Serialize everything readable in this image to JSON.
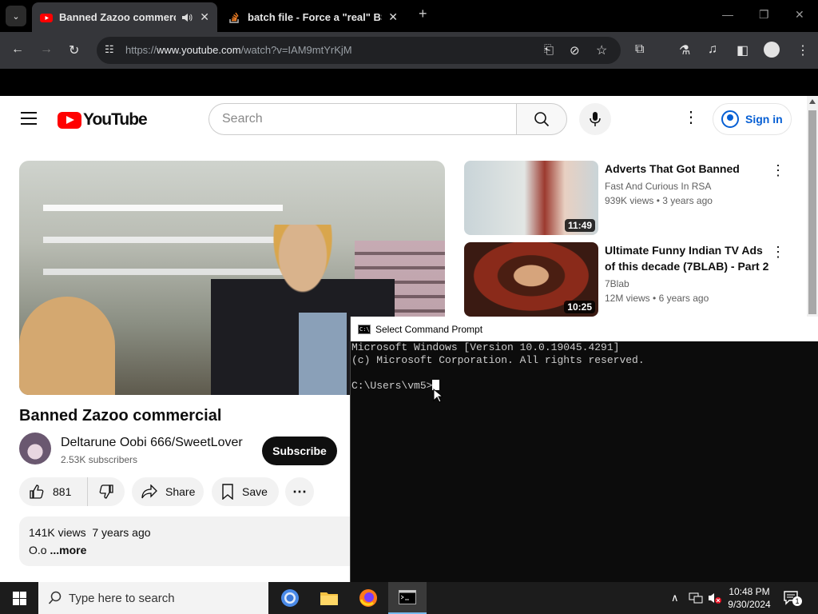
{
  "browser": {
    "tabs": [
      {
        "title": "Banned Zazoo commercial",
        "active": true,
        "audio": true
      },
      {
        "title": "batch file - Force a \"real\" BSoD",
        "active": false
      }
    ],
    "url_prefix": "https://",
    "url_host": "www.youtube.com",
    "url_path": "/watch?v=IAM9mtYrKjM"
  },
  "youtube": {
    "logo_text": "YouTube",
    "search_placeholder": "Search",
    "signin_label": "Sign in",
    "video": {
      "title": "Banned Zazoo commercial",
      "channel": "Deltarune Oobi 666/SweetLover",
      "subscribers": "2.53K subscribers",
      "subscribe_label": "Subscribe",
      "likes": "881",
      "share_label": "Share",
      "save_label": "Save",
      "views": "141K views",
      "age": "7 years ago",
      "description": "O.o",
      "more_label": "...more"
    },
    "recommendations": [
      {
        "title": "Adverts That Got Banned",
        "channel": "Fast And Curious In RSA",
        "views": "939K views",
        "age": "3 years ago",
        "duration": "11:49"
      },
      {
        "title": "Ultimate Funny Indian TV Ads of this decade (7BLAB) - Part 2",
        "channel": "7Blab",
        "views": "12M views",
        "age": "6 years ago",
        "duration": "10:25"
      }
    ]
  },
  "cmd": {
    "title": "Select Command Prompt",
    "lines": [
      "Microsoft Windows [Version 10.0.19045.4291]",
      "(c) Microsoft Corporation. All rights reserved.",
      "",
      "C:\\Users\\vm5>"
    ]
  },
  "taskbar": {
    "search_placeholder": "Type here to search",
    "time": "10:48 PM",
    "date": "9/30/2024",
    "notification_count": "1"
  }
}
